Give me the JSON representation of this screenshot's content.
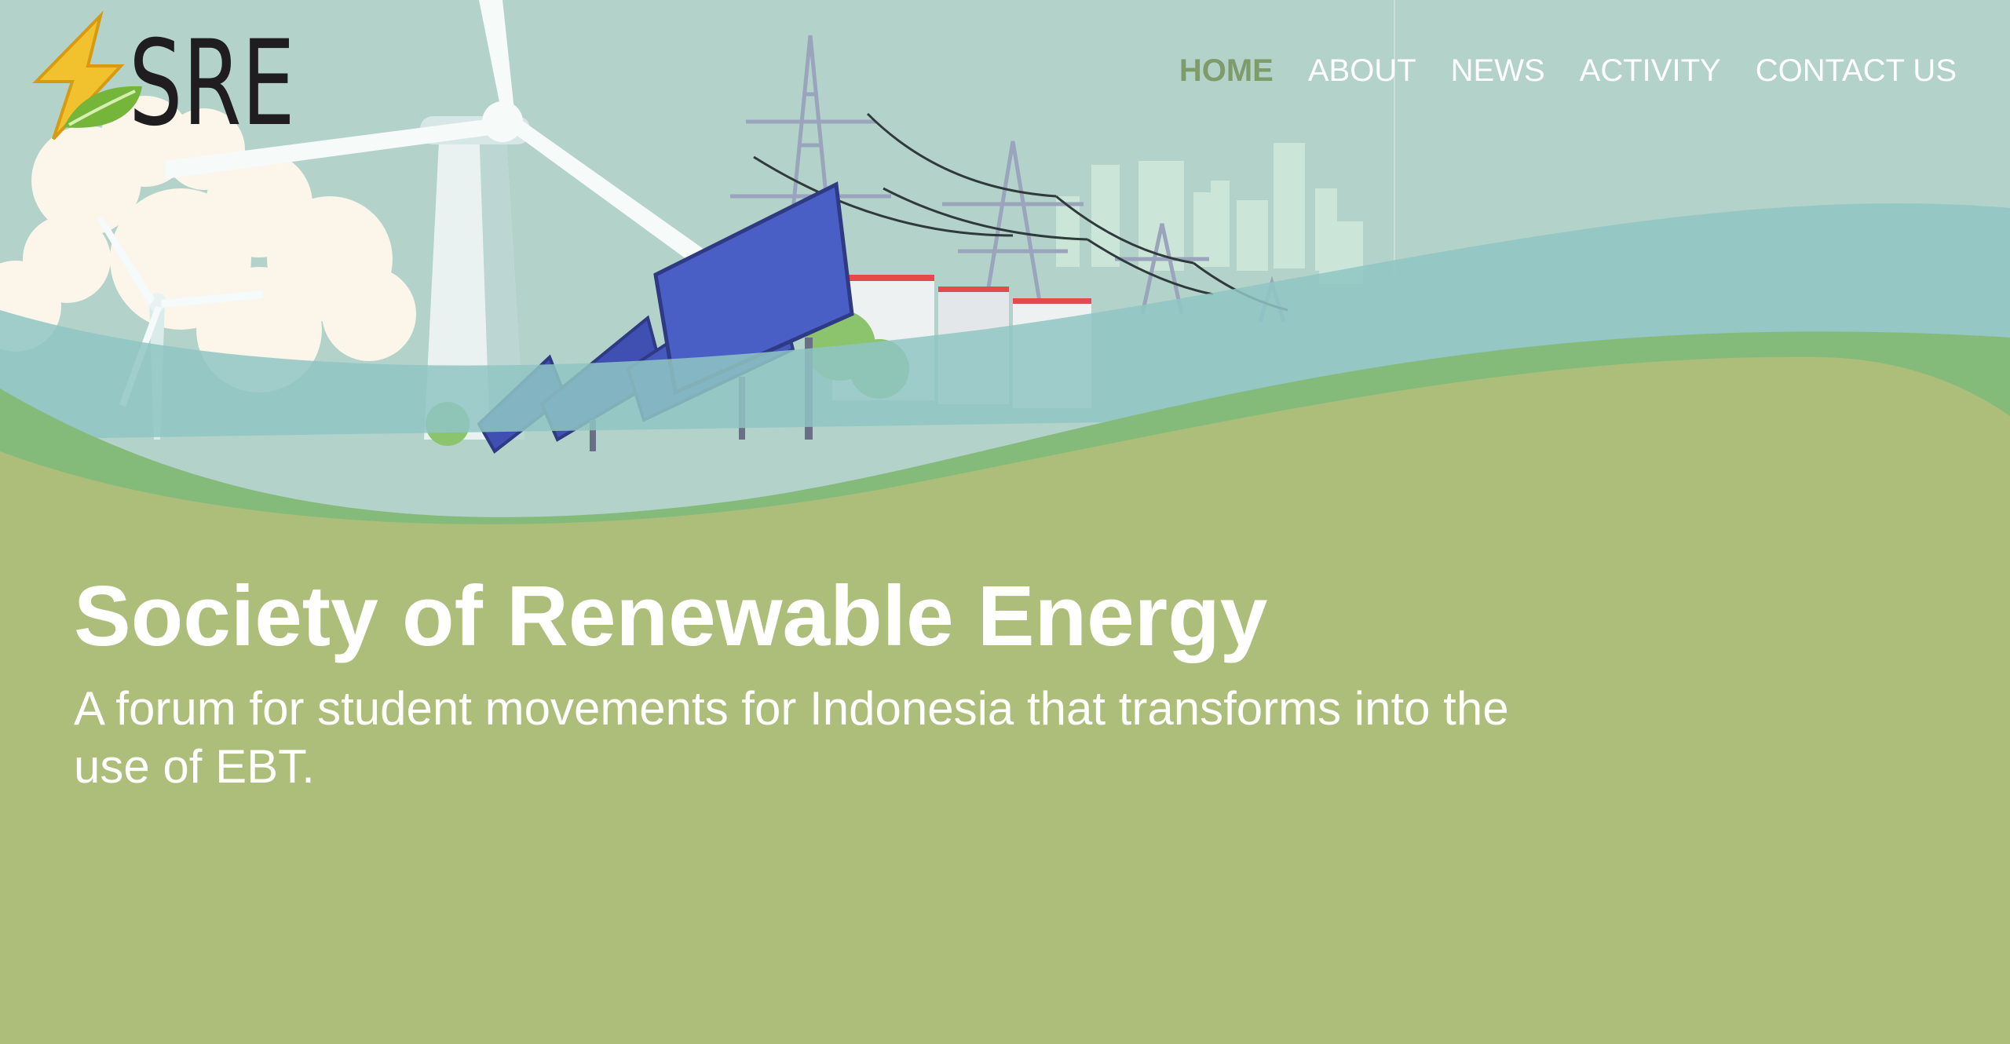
{
  "brand": {
    "logo_text": "SRE",
    "logo_icon": "lightning-leaf-icon"
  },
  "nav": {
    "items": [
      {
        "label": "HOME",
        "active": true
      },
      {
        "label": "ABOUT",
        "active": false
      },
      {
        "label": "NEWS",
        "active": false
      },
      {
        "label": "ACTIVITY",
        "active": false
      },
      {
        "label": "CONTACT US",
        "active": false
      }
    ]
  },
  "hero": {
    "title": "Society of Renewable Energy",
    "subtitle": "A forum for student movements for Indonesia that transforms into the use of EBT."
  },
  "colors": {
    "sky": "#b3d2c9",
    "ground": "#adbe7a",
    "hill": "#84bb7b",
    "water": "#8fc5c3",
    "nav_active": "#7e9b6a",
    "text": "#ffffff",
    "logo_text": "#1f1d1f",
    "panel_blue": "#3e50b0"
  }
}
